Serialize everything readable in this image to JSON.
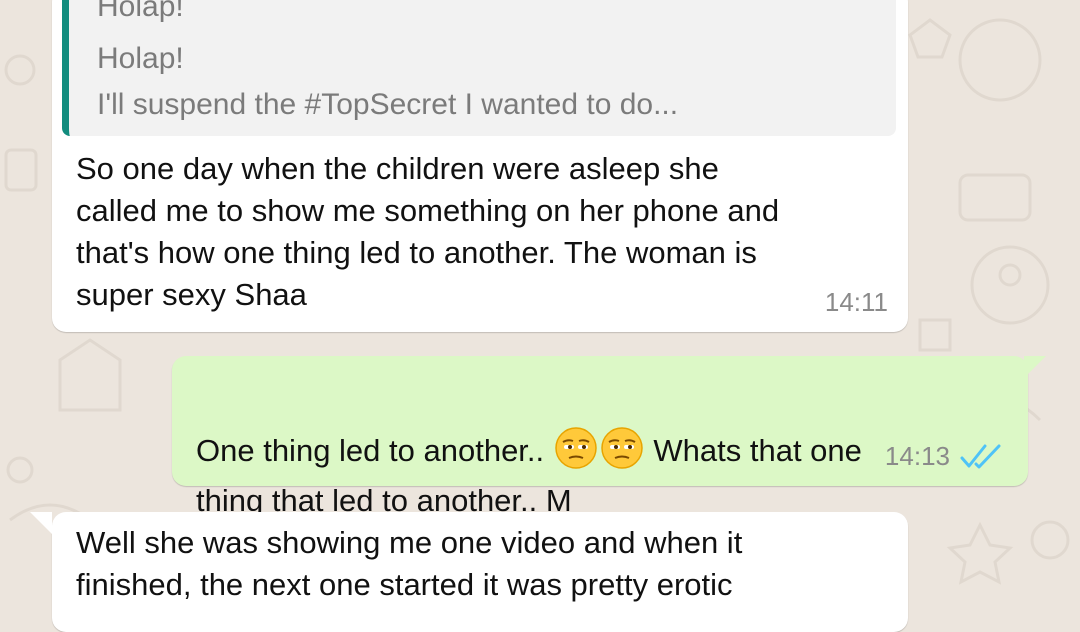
{
  "messages": [
    {
      "direction": "incoming",
      "quoted_lines": [
        "Holap!",
        "Holap!",
        "I'll suspend the #TopSecret I wanted to do..."
      ],
      "text": "So one day when the children were asleep she\ncalled me to show me something on her phone and\nthat's how one thing led to another. The woman is\nsuper sexy Shaa",
      "time": "14:11"
    },
    {
      "direction": "outgoing",
      "text_before_emoji": "One thing led to another.. ",
      "emoji_name": "unamused-face",
      "text_after_emoji": " Whats that one",
      "text_line2": "thing that led to another.. M",
      "time": "14:13",
      "status": "read"
    },
    {
      "direction": "incoming",
      "text": "Well she was showing me one video and when it\nfinished, the next one started it was pretty erotic"
    }
  ],
  "colors": {
    "background": "#ECE5DD",
    "incoming_bubble": "#FFFFFF",
    "outgoing_bubble": "#DCF8C6",
    "quote_bar": "#128C7E",
    "read_ticks": "#4FC3F7"
  }
}
